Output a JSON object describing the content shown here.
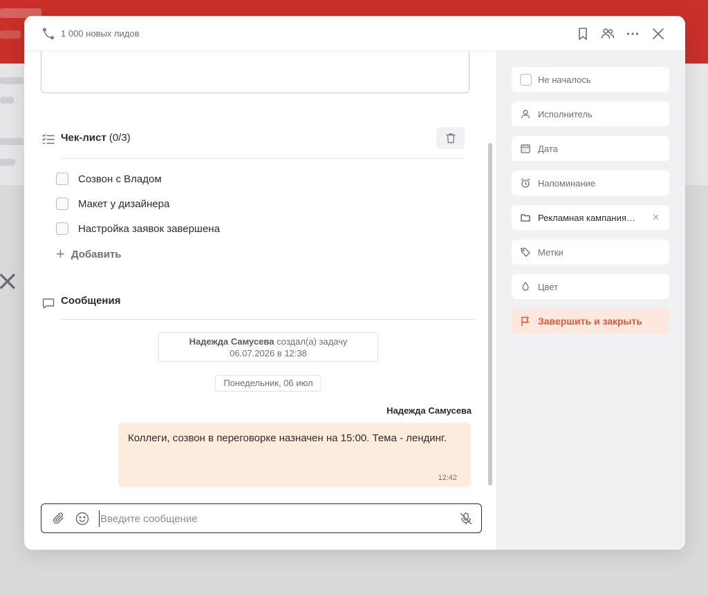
{
  "header": {
    "title": "1 000 новых лидов",
    "icons": [
      "phone-icon",
      "bookmark-icon",
      "users-icon",
      "more-icon",
      "close-icon"
    ]
  },
  "checklist": {
    "title": "Чек-лист",
    "count": "(0/3)",
    "items": [
      {
        "label": "Созвон с Владом",
        "checked": false
      },
      {
        "label": "Макет у дизайнера",
        "checked": false
      },
      {
        "label": "Настройка заявок завершена",
        "checked": false
      }
    ],
    "add_label": "Добавить"
  },
  "messages": {
    "title": "Сообщения",
    "system": {
      "author": "Надежда Самусева",
      "action": "создал(а) задачу",
      "datetime": "06.07.2026 в 12:38"
    },
    "day_label": "Понедельник, 06 июл",
    "thread": [
      {
        "author": "Надежда Самусева",
        "text": "Коллеги, созвон в переговорке назначен на 15:00. Тема - лендинг.",
        "time": "12:42"
      }
    ]
  },
  "composer": {
    "placeholder": "Введите сообщение"
  },
  "sidebar": {
    "status": "Не началось",
    "assignee": "Исполнитель",
    "date": "Дата",
    "reminder": "Напоминание",
    "project": "Рекламная кампания…",
    "tags": "Метки",
    "color": "Цвет",
    "finish": "Завершить и закрыть"
  },
  "colors": {
    "accent": "#e4572e",
    "accent_bg": "#fde7de",
    "bubble_bg": "#fdecde",
    "topbar": "#c9302a"
  }
}
